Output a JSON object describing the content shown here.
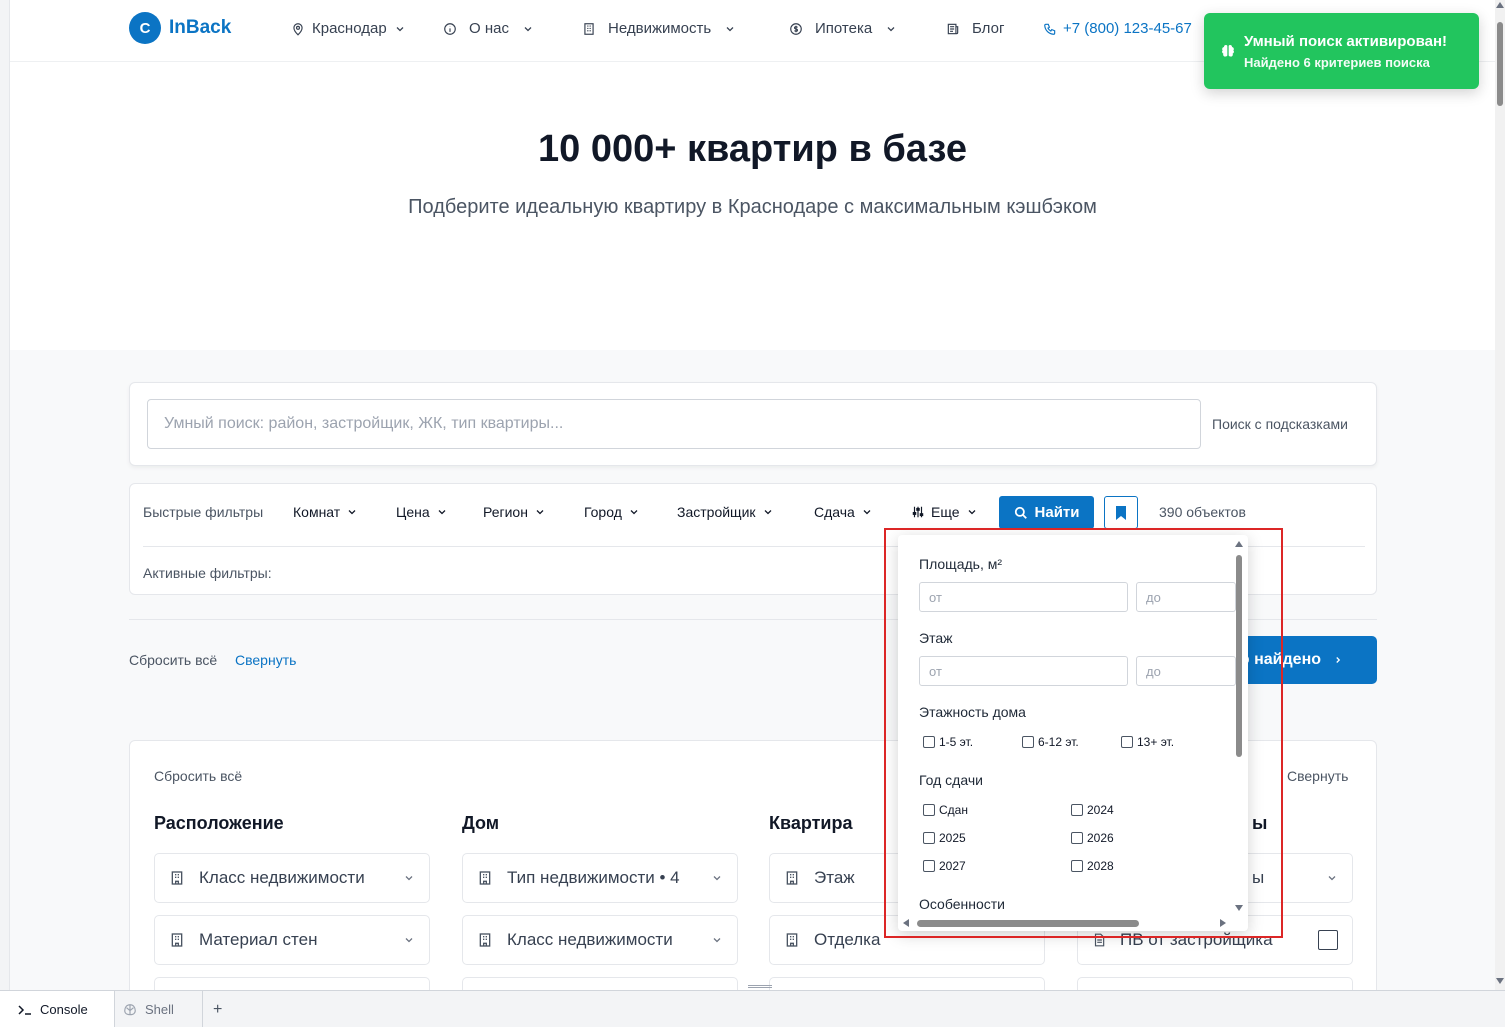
{
  "header": {
    "logo_letter": "C",
    "logo_text": "InBack",
    "nav": [
      {
        "label": "Краснодар",
        "icon": "map-pin-icon"
      },
      {
        "label": "О нас",
        "icon": "info-icon"
      },
      {
        "label": "Недвижимость",
        "icon": "building-icon"
      },
      {
        "label": "Ипотека",
        "icon": "dollar-icon"
      },
      {
        "label": "Блог",
        "icon": "newspaper-icon"
      }
    ],
    "phone": "+7 (800) 123-45-67"
  },
  "toast": {
    "title": "Умный поиск активирован!",
    "subtitle": "Найдено 6 критериев поиска",
    "color": "#22c55e"
  },
  "hero": {
    "title": "10 000+ квартир в базе",
    "subtitle": "Подберите идеальную квартиру в Краснодаре с максимальным кэшбэком"
  },
  "search": {
    "placeholder": "Умный поиск: район, застройщик, ЖК, тип квартиры...",
    "hint_label": "Поиск с подсказками"
  },
  "filters": {
    "quick_label": "Быстрые фильтры",
    "buttons": [
      "Комнат",
      "Цена",
      "Регион",
      "Город",
      "Застройщик",
      "Сдача",
      "Еще"
    ],
    "find_label": "Найти",
    "count": "390 объектов",
    "active_label": "Активные фильтры:"
  },
  "results": {
    "reset": "Сбросить всё",
    "collapse": "Свернуть",
    "show_button": "о найдено"
  },
  "extended": {
    "reset": "Сбросить всё",
    "collapse": "Свернуть",
    "columns": [
      {
        "title": "Расположение",
        "items": [
          "Класс недвижимости",
          "Материал стен"
        ]
      },
      {
        "title": "Дом",
        "items": [
          "Тип недвижимости • 4",
          "Класс недвижимости"
        ]
      },
      {
        "title": "Квартира",
        "items": [
          "Этаж",
          "Отделка"
        ]
      },
      {
        "title": "ы",
        "items": [
          "ы",
          "ПВ от застройщика"
        ]
      }
    ]
  },
  "popup": {
    "area_label": "Площадь, м²",
    "floor_label": "Этаж",
    "from_placeholder": "от",
    "to_placeholder": "до",
    "storeys_label": "Этажность дома",
    "storeys": [
      "1-5 эт.",
      "6-12 эт.",
      "13+ эт."
    ],
    "year_label": "Год сдачи",
    "years": [
      "Сдан",
      "2024",
      "2025",
      "2026",
      "2027",
      "2028"
    ],
    "features_label": "Особенности"
  },
  "bottombar": {
    "console": "Console",
    "shell": "Shell",
    "add": "+"
  },
  "colors": {
    "accent": "#0b74c4",
    "highlight": "#dc2626"
  }
}
